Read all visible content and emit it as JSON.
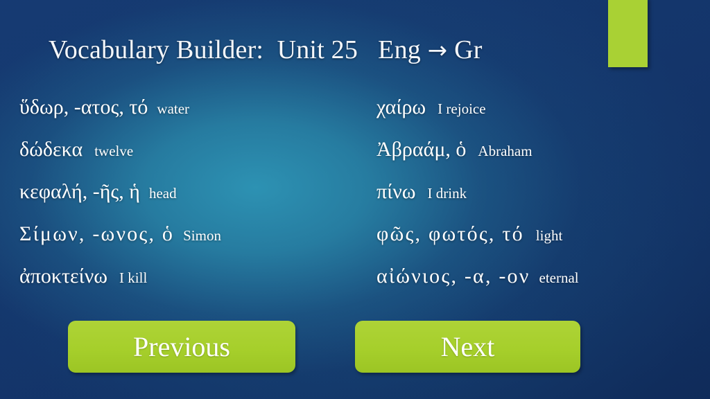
{
  "slide": {
    "title": "Vocabulary Builder:  Unit 25   Eng ",
    "title_arrow": "→",
    "title_suffix": " Gr",
    "accent_color": "#a9d134",
    "background_color": "#123163",
    "text_color": "#ffffff"
  },
  "vocabulary": {
    "left_column": [
      {
        "greek": "ὕδωρ, -ατος, τό",
        "gloss": "water"
      },
      {
        "greek": "δώδεκα",
        "gloss": "twelve"
      },
      {
        "greek": "κεφαλή, -ῆς, ἡ",
        "gloss": "head"
      },
      {
        "greek": "Σίμων, -ωνος, ὁ",
        "gloss": "Simon"
      },
      {
        "greek": "ἀποκτείνω",
        "gloss": "I kill"
      }
    ],
    "right_column": [
      {
        "greek": "χαίρω",
        "gloss": "I rejoice"
      },
      {
        "greek": "Ἀβραάμ, ὁ",
        "gloss": "Abraham"
      },
      {
        "greek": "πίνω",
        "gloss": "I drink"
      },
      {
        "greek": "φῶς, φωτός, τό",
        "gloss": "light"
      },
      {
        "greek": "αἰώνιος, -α, -ον",
        "gloss": "eternal"
      }
    ]
  },
  "navigation": {
    "previous_label": "Previous",
    "next_label": "Next",
    "button_color": "#a8d02f"
  }
}
